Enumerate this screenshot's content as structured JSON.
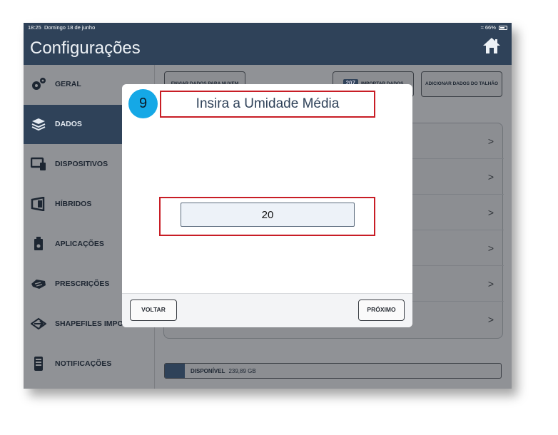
{
  "status_bar": {
    "time": "18:25",
    "date": "Domingo 18 de junho",
    "battery": "66%"
  },
  "header": {
    "title": "Configurações",
    "home_icon": "home-icon"
  },
  "sidebar": {
    "items": [
      {
        "label": "GERAL",
        "icon": "gear-icon"
      },
      {
        "label": "DADOS",
        "icon": "database-icon",
        "active": true
      },
      {
        "label": "DISPOSITIVOS",
        "icon": "devices-icon"
      },
      {
        "label": "HÍBRIDOS",
        "icon": "hybrid-icon"
      },
      {
        "label": "APLICAÇÕES",
        "icon": "application-icon"
      },
      {
        "label": "PRESCRIÇÕES",
        "icon": "prescription-icon"
      },
      {
        "label": "SHAPEFILES IMPOR",
        "icon": "shapefile-icon"
      },
      {
        "label": "NOTIFICAÇÕES",
        "icon": "notification-icon"
      }
    ]
  },
  "main": {
    "top_buttons": {
      "send": "ENVIAR DADOS PARA NUVEM",
      "import_count": "207",
      "import": "IMPORTAR DADOS",
      "add": "ADICIONAR DADOS DO TALHÃO"
    },
    "rows": [
      ">",
      ">",
      ">",
      ">",
      ">",
      ">"
    ],
    "storage": {
      "label": "DISPONÍVEL",
      "value": "239,89 GB"
    }
  },
  "modal": {
    "step": "9",
    "title": "Insira a Umidade Média",
    "input_value": "20",
    "back_label": "VOLTAR",
    "next_label": "PRÓXIMO"
  },
  "colors": {
    "brand": "#2f4259",
    "highlight": "#c81d25",
    "step_badge": "#15a8e6"
  }
}
